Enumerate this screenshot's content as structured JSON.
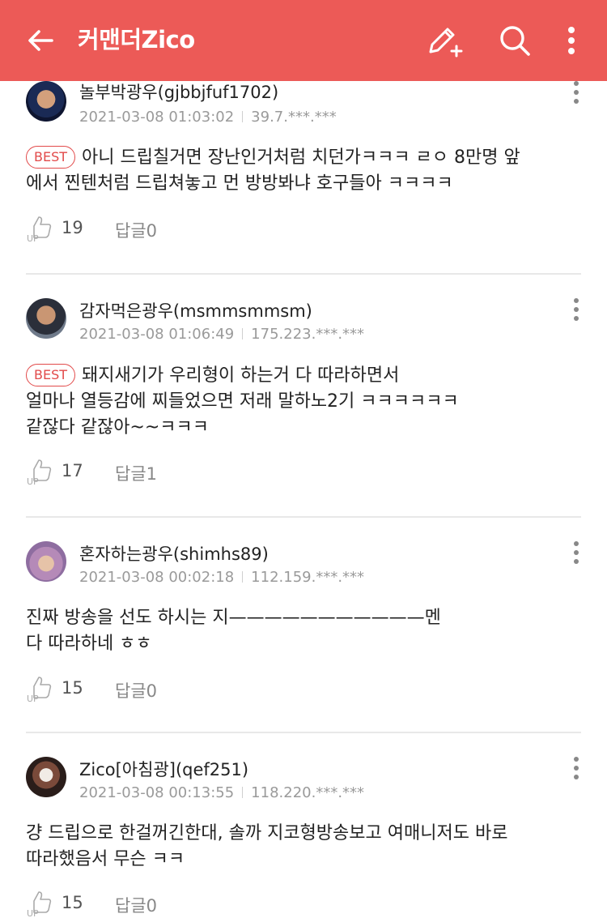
{
  "header": {
    "title": "커맨더Zico",
    "bg_color": "#ec5a57"
  },
  "comments": [
    {
      "nick": "놀부박광우(gjbbjfuf1702)",
      "datetime": "2021-03-08 01:03:02",
      "ip": "39.7.***.***",
      "best": true,
      "best_label": "BEST",
      "lines": [
        "아니 드립칠거면 장난인거처럼 치던가ㅋㅋㅋ ㄹㅇ 8만명 앞",
        "에서 찐텐처럼 드립쳐놓고 먼 방방봐냐 호구들아 ㅋㅋㅋㅋ"
      ],
      "likes": "19",
      "reply_label": "답글0"
    },
    {
      "nick": "감자먹은광우(msmmsmmsm)",
      "datetime": "2021-03-08 01:06:49",
      "ip": "175.223.***.***",
      "best": true,
      "best_label": "BEST",
      "lines": [
        "돼지새기가 우리형이 하는거 다 따라하면서",
        "얼마나 열등감에 찌들었으면 저래 말하노2기 ㅋㅋㅋㅋㅋㅋ",
        "같잖다 같잖아~~ㅋㅋㅋ"
      ],
      "likes": "17",
      "reply_label": "답글1"
    },
    {
      "nick": "혼자하는광우(shimhs89)",
      "datetime": "2021-03-08 00:02:18",
      "ip": "112.159.***.***",
      "best": false,
      "lines": [
        "진짜 방송을 선도 하시는 지———————————멘",
        "다 따라하네 ㅎㅎ"
      ],
      "likes": "15",
      "reply_label": "답글0"
    },
    {
      "nick": "Zico[아침광](qef251)",
      "datetime": "2021-03-08 00:13:55",
      "ip": "118.220.***.***",
      "best": false,
      "lines": [
        "걍 드립으로 한걸꺼긴한대, 솔까  지코형방송보고  여매니저도 바로",
        "따라했음서 무슨 ㅋㅋ"
      ],
      "likes": "15",
      "reply_label": "답글0"
    }
  ],
  "icons": {
    "back": "arrow-left-icon",
    "write": "pencil-plus-icon",
    "search": "search-icon",
    "more": "kebab-menu-icon",
    "like": "thumbs-up-icon"
  }
}
